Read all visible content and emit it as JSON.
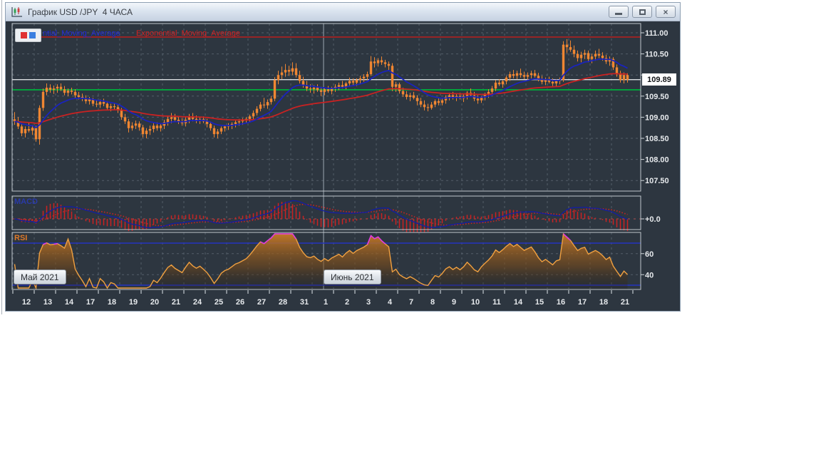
{
  "window": {
    "title": "График USD /JPY  4 ЧАСА",
    "controls": {
      "minimize": "minimize",
      "maximize": "maximize",
      "close_glyph": "×"
    }
  },
  "legend": {
    "swatch_colors": [
      "#e03232",
      "#3b7fe0"
    ],
    "items": [
      {
        "label": "ntial_Moving_Average",
        "color": "#2228d8"
      },
      {
        "label": "Exponential_Moving_Average",
        "color": "#d42020"
      }
    ]
  },
  "panels": {
    "macd_label": "MACD",
    "rsi_label": "RSI"
  },
  "months": [
    {
      "label": "Май 2021"
    },
    {
      "label": "Июнь 2021"
    }
  ],
  "price_axis": {
    "current_price": "109.89",
    "labels": [
      {
        "text": "111.00",
        "price": 111.0
      },
      {
        "text": "110.50",
        "price": 110.5
      },
      {
        "text": "109.50",
        "price": 109.5
      },
      {
        "text": "109.00",
        "price": 109.0
      },
      {
        "text": "108.50",
        "price": 108.5
      },
      {
        "text": "108.00",
        "price": 108.0
      },
      {
        "text": "107.50",
        "price": 107.5
      }
    ],
    "gridlines": [
      111.0,
      110.5,
      110.0,
      109.5,
      109.0,
      108.5,
      108.0,
      107.5
    ]
  },
  "macd_axis": {
    "zero_label": "+0.0"
  },
  "rsi_axis": {
    "labels": [
      {
        "text": "60",
        "value": 60
      },
      {
        "text": "40",
        "value": 40
      }
    ],
    "levels": [
      70,
      30
    ]
  },
  "x_axis": {
    "day_labels": [
      "12",
      "13",
      "14",
      "17",
      "18",
      "19",
      "20",
      "21",
      "24",
      "25",
      "26",
      "27",
      "28",
      "31",
      "1",
      "2",
      "3",
      "4",
      "7",
      "8",
      "9",
      "10",
      "11",
      "14",
      "15",
      "16",
      "17",
      "18",
      "21"
    ]
  },
  "chart_data": {
    "type": "candlestick",
    "symbol": "USD/JPY",
    "timeframe": "4H",
    "title": "График USD /JPY  4 ЧАСА",
    "ylim": [
      107.25,
      111.22
    ],
    "grid": true,
    "june_separator_after_day_index": 13,
    "levels": [
      {
        "name": "resistance-line",
        "price": 110.9,
        "color": "#b22020",
        "style": "solid"
      },
      {
        "name": "current-price-line",
        "price": 109.89,
        "color": "#dcdfe2",
        "style": "solid"
      },
      {
        "name": "support-line",
        "price": 109.65,
        "color": "#00a83c",
        "style": "solid"
      }
    ],
    "indicators": {
      "ema_fast": {
        "period": 13,
        "color": "#1a24bc",
        "label": "ntial_Moving_Average"
      },
      "ema_slow": {
        "period": 55,
        "color": "#c82222",
        "label": "Exponential_Moving_Average"
      },
      "macd": {
        "fast": 12,
        "slow": 26,
        "signal": 9,
        "line_color": "#151f9e",
        "signal_color": "#cc2222",
        "zero_label": "+0.0"
      },
      "rsi": {
        "period": 14,
        "color": "#f0a040",
        "overbought_color": "#e03ae0",
        "levels": [
          70,
          30
        ],
        "tick_labels": [
          60,
          40
        ]
      }
    },
    "candle_color": "#ef8632",
    "candles_per_day": 6,
    "candles": [
      [
        108.95,
        109.12,
        108.82,
        108.9
      ],
      [
        108.9,
        109.0,
        108.72,
        108.78
      ],
      [
        108.78,
        108.86,
        108.55,
        108.62
      ],
      [
        108.62,
        108.78,
        108.52,
        108.72
      ],
      [
        108.72,
        108.88,
        108.64,
        108.68
      ],
      [
        108.68,
        108.82,
        108.58,
        108.75
      ],
      [
        108.75,
        108.8,
        108.42,
        108.48
      ],
      [
        108.48,
        109.28,
        108.35,
        109.22
      ],
      [
        109.22,
        109.68,
        109.15,
        109.6
      ],
      [
        109.6,
        109.8,
        109.52,
        109.7
      ],
      [
        109.7,
        109.78,
        109.58,
        109.65
      ],
      [
        109.65,
        109.75,
        109.55,
        109.68
      ],
      [
        109.68,
        109.78,
        109.58,
        109.72
      ],
      [
        109.72,
        109.8,
        109.62,
        109.66
      ],
      [
        109.66,
        109.74,
        109.52,
        109.58
      ],
      [
        109.58,
        109.68,
        109.5,
        109.63
      ],
      [
        109.63,
        109.7,
        109.54,
        109.6
      ],
      [
        109.6,
        109.66,
        109.46,
        109.52
      ],
      [
        109.52,
        109.6,
        109.42,
        109.48
      ],
      [
        109.48,
        109.56,
        109.38,
        109.44
      ],
      [
        109.44,
        109.52,
        109.32,
        109.38
      ],
      [
        109.38,
        109.48,
        109.3,
        109.42
      ],
      [
        109.42,
        109.46,
        109.26,
        109.32
      ],
      [
        109.32,
        109.4,
        109.24,
        109.3
      ],
      [
        109.3,
        109.42,
        109.22,
        109.36
      ],
      [
        109.36,
        109.44,
        109.26,
        109.32
      ],
      [
        109.32,
        109.38,
        109.16,
        109.22
      ],
      [
        109.22,
        109.32,
        109.14,
        109.26
      ],
      [
        109.26,
        109.34,
        109.18,
        109.24
      ],
      [
        109.24,
        109.3,
        109.1,
        109.16
      ],
      [
        109.16,
        109.22,
        108.94,
        109.0
      ],
      [
        109.0,
        109.08,
        108.84,
        108.9
      ],
      [
        108.9,
        108.96,
        108.64,
        108.74
      ],
      [
        108.74,
        108.88,
        108.68,
        108.8
      ],
      [
        108.8,
        108.92,
        108.72,
        108.85
      ],
      [
        108.85,
        108.9,
        108.68,
        108.76
      ],
      [
        108.76,
        108.82,
        108.52,
        108.6
      ],
      [
        108.6,
        108.74,
        108.5,
        108.68
      ],
      [
        108.68,
        108.8,
        108.58,
        108.72
      ],
      [
        108.72,
        108.86,
        108.64,
        108.8
      ],
      [
        108.8,
        108.88,
        108.68,
        108.74
      ],
      [
        108.74,
        108.84,
        108.66,
        108.8
      ],
      [
        108.8,
        108.94,
        108.72,
        108.88
      ],
      [
        108.88,
        109.04,
        108.8,
        108.96
      ],
      [
        108.96,
        109.1,
        108.86,
        109.0
      ],
      [
        109.0,
        109.08,
        108.88,
        108.94
      ],
      [
        108.94,
        109.02,
        108.84,
        108.9
      ],
      [
        108.9,
        108.98,
        108.8,
        108.86
      ],
      [
        108.86,
        109.0,
        108.78,
        108.94
      ],
      [
        108.94,
        109.08,
        108.86,
        109.02
      ],
      [
        109.02,
        109.1,
        108.9,
        108.96
      ],
      [
        108.96,
        109.04,
        108.86,
        108.92
      ],
      [
        108.92,
        109.0,
        108.84,
        108.95
      ],
      [
        108.95,
        109.02,
        108.86,
        108.9
      ],
      [
        108.9,
        108.96,
        108.76,
        108.84
      ],
      [
        108.84,
        108.9,
        108.68,
        108.74
      ],
      [
        108.74,
        108.8,
        108.52,
        108.6
      ],
      [
        108.6,
        108.72,
        108.5,
        108.66
      ],
      [
        108.66,
        108.78,
        108.6,
        108.74
      ],
      [
        108.74,
        108.82,
        108.66,
        108.78
      ],
      [
        108.78,
        108.86,
        108.7,
        108.8
      ],
      [
        108.8,
        108.88,
        108.72,
        108.84
      ],
      [
        108.84,
        108.92,
        108.76,
        108.88
      ],
      [
        108.88,
        108.96,
        108.8,
        108.9
      ],
      [
        108.9,
        108.98,
        108.82,
        108.93
      ],
      [
        108.93,
        109.0,
        108.85,
        108.96
      ],
      [
        108.96,
        109.06,
        108.88,
        109.02
      ],
      [
        109.02,
        109.16,
        108.95,
        109.1
      ],
      [
        109.1,
        109.26,
        109.04,
        109.2
      ],
      [
        109.2,
        109.36,
        109.14,
        109.3
      ],
      [
        109.3,
        109.46,
        109.22,
        109.28
      ],
      [
        109.28,
        109.42,
        109.2,
        109.36
      ],
      [
        109.36,
        109.5,
        109.3,
        109.44
      ],
      [
        109.44,
        109.95,
        109.38,
        109.88
      ],
      [
        109.88,
        110.1,
        109.78,
        110.0
      ],
      [
        110.0,
        110.2,
        109.9,
        110.06
      ],
      [
        110.06,
        110.26,
        109.96,
        110.12
      ],
      [
        110.12,
        110.22,
        109.98,
        110.08
      ],
      [
        110.08,
        110.3,
        110.0,
        110.16
      ],
      [
        110.16,
        110.28,
        109.94,
        110.0
      ],
      [
        110.0,
        110.1,
        109.8,
        109.86
      ],
      [
        109.86,
        109.96,
        109.7,
        109.76
      ],
      [
        109.76,
        109.86,
        109.62,
        109.68
      ],
      [
        109.68,
        109.78,
        109.58,
        109.66
      ],
      [
        109.66,
        109.76,
        109.56,
        109.7
      ],
      [
        109.7,
        109.78,
        109.6,
        109.64
      ],
      [
        109.64,
        109.72,
        109.5,
        109.6
      ],
      [
        109.6,
        109.7,
        109.52,
        109.66
      ],
      [
        109.66,
        109.74,
        109.58,
        109.62
      ],
      [
        109.62,
        109.72,
        109.54,
        109.68
      ],
      [
        109.68,
        109.78,
        109.6,
        109.72
      ],
      [
        109.72,
        109.82,
        109.64,
        109.76
      ],
      [
        109.76,
        109.86,
        109.68,
        109.72
      ],
      [
        109.72,
        109.84,
        109.66,
        109.8
      ],
      [
        109.8,
        109.94,
        109.72,
        109.86
      ],
      [
        109.86,
        109.92,
        109.76,
        109.82
      ],
      [
        109.82,
        109.92,
        109.74,
        109.88
      ],
      [
        109.88,
        109.98,
        109.8,
        109.92
      ],
      [
        109.92,
        110.02,
        109.84,
        109.96
      ],
      [
        109.96,
        110.08,
        109.88,
        110.02
      ],
      [
        110.02,
        110.45,
        109.98,
        110.32
      ],
      [
        110.32,
        110.42,
        110.18,
        110.28
      ],
      [
        110.28,
        110.4,
        110.2,
        110.35
      ],
      [
        110.35,
        110.44,
        110.24,
        110.3
      ],
      [
        110.3,
        110.36,
        110.18,
        110.26
      ],
      [
        110.26,
        110.32,
        110.12,
        110.22
      ],
      [
        110.22,
        110.28,
        109.62,
        109.72
      ],
      [
        109.72,
        109.84,
        109.6,
        109.78
      ],
      [
        109.78,
        109.82,
        109.56,
        109.62
      ],
      [
        109.62,
        109.7,
        109.48,
        109.54
      ],
      [
        109.54,
        109.62,
        109.42,
        109.48
      ],
      [
        109.48,
        109.58,
        109.38,
        109.52
      ],
      [
        109.52,
        109.6,
        109.42,
        109.46
      ],
      [
        109.46,
        109.52,
        109.28,
        109.38
      ],
      [
        109.38,
        109.46,
        109.24,
        109.3
      ],
      [
        109.3,
        109.4,
        109.16,
        109.24
      ],
      [
        109.24,
        109.32,
        109.14,
        109.22
      ],
      [
        109.22,
        109.36,
        109.18,
        109.3
      ],
      [
        109.3,
        109.42,
        109.24,
        109.38
      ],
      [
        109.38,
        109.46,
        109.28,
        109.34
      ],
      [
        109.34,
        109.46,
        109.28,
        109.4
      ],
      [
        109.4,
        109.52,
        109.32,
        109.48
      ],
      [
        109.48,
        109.58,
        109.4,
        109.52
      ],
      [
        109.52,
        109.6,
        109.42,
        109.46
      ],
      [
        109.46,
        109.56,
        109.38,
        109.5
      ],
      [
        109.5,
        109.58,
        109.42,
        109.45
      ],
      [
        109.45,
        109.56,
        109.36,
        109.5
      ],
      [
        109.5,
        109.62,
        109.42,
        109.58
      ],
      [
        109.58,
        109.68,
        109.48,
        109.52
      ],
      [
        109.52,
        109.6,
        109.38,
        109.44
      ],
      [
        109.44,
        109.52,
        109.32,
        109.4
      ],
      [
        109.4,
        109.5,
        109.34,
        109.48
      ],
      [
        109.48,
        109.58,
        109.4,
        109.54
      ],
      [
        109.54,
        109.66,
        109.46,
        109.6
      ],
      [
        109.6,
        109.74,
        109.52,
        109.68
      ],
      [
        109.68,
        109.88,
        109.62,
        109.82
      ],
      [
        109.82,
        109.9,
        109.74,
        109.78
      ],
      [
        109.78,
        109.88,
        109.7,
        109.85
      ],
      [
        109.85,
        109.98,
        109.78,
        109.94
      ],
      [
        109.94,
        110.08,
        109.86,
        110.02
      ],
      [
        110.02,
        110.12,
        109.92,
        109.98
      ],
      [
        109.98,
        110.1,
        109.9,
        110.04
      ],
      [
        110.04,
        110.15,
        109.94,
        110.0
      ],
      [
        110.0,
        110.08,
        109.9,
        109.96
      ],
      [
        109.96,
        110.06,
        109.88,
        110.0
      ],
      [
        110.0,
        110.1,
        109.92,
        110.04
      ],
      [
        110.04,
        110.12,
        109.94,
        109.98
      ],
      [
        109.98,
        110.05,
        109.85,
        109.9
      ],
      [
        109.9,
        109.98,
        109.78,
        109.84
      ],
      [
        109.84,
        109.94,
        109.76,
        109.88
      ],
      [
        109.88,
        109.96,
        109.8,
        109.84
      ],
      [
        109.84,
        109.92,
        109.74,
        109.8
      ],
      [
        109.8,
        109.9,
        109.72,
        109.86
      ],
      [
        109.86,
        109.94,
        109.78,
        109.88
      ],
      [
        109.88,
        110.8,
        109.84,
        110.72
      ],
      [
        110.72,
        110.85,
        110.52,
        110.66
      ],
      [
        110.66,
        110.82,
        110.55,
        110.6
      ],
      [
        110.6,
        110.7,
        110.42,
        110.5
      ],
      [
        110.5,
        110.58,
        110.32,
        110.4
      ],
      [
        110.4,
        110.55,
        110.3,
        110.48
      ],
      [
        110.48,
        110.6,
        110.38,
        110.52
      ],
      [
        110.52,
        110.58,
        110.3,
        110.38
      ],
      [
        110.38,
        110.5,
        110.28,
        110.44
      ],
      [
        110.44,
        110.58,
        110.34,
        110.5
      ],
      [
        110.5,
        110.62,
        110.4,
        110.46
      ],
      [
        110.46,
        110.54,
        110.34,
        110.4
      ],
      [
        110.4,
        110.48,
        110.26,
        110.32
      ],
      [
        110.32,
        110.44,
        110.22,
        110.38
      ],
      [
        110.38,
        110.42,
        110.12,
        110.18
      ],
      [
        110.18,
        110.25,
        109.96,
        110.04
      ],
      [
        110.04,
        110.1,
        109.82,
        109.88
      ],
      [
        109.88,
        110.06,
        109.8,
        110.0
      ],
      [
        110.0,
        110.04,
        109.82,
        109.89
      ]
    ]
  }
}
